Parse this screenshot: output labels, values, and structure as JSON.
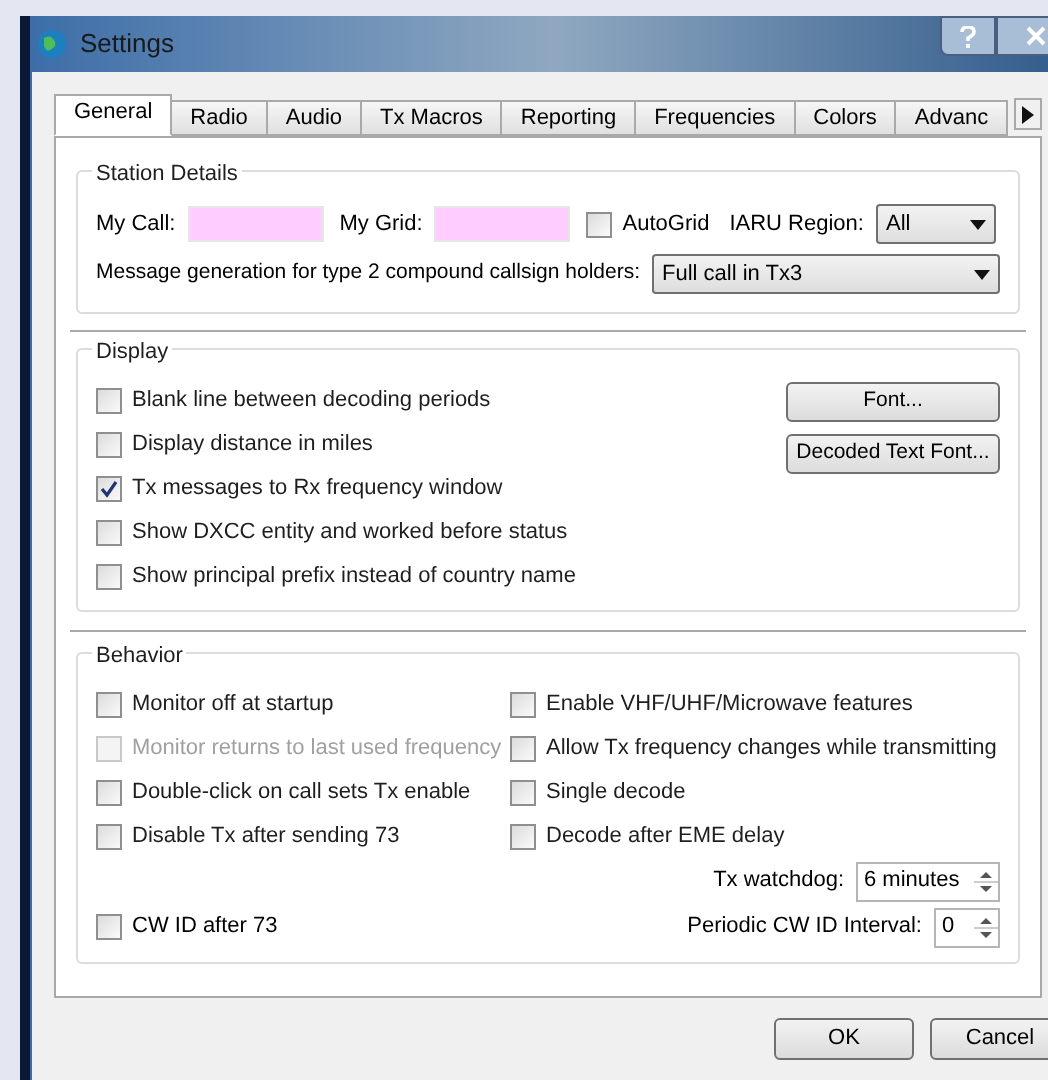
{
  "window": {
    "title": "Settings"
  },
  "tabs": [
    {
      "label": "General",
      "selected": true
    },
    {
      "label": "Radio",
      "selected": false
    },
    {
      "label": "Audio",
      "selected": false
    },
    {
      "label": "Tx Macros",
      "selected": false
    },
    {
      "label": "Reporting",
      "selected": false
    },
    {
      "label": "Frequencies",
      "selected": false
    },
    {
      "label": "Colors",
      "selected": false
    },
    {
      "label": "Advanc",
      "selected": false
    }
  ],
  "station_details": {
    "title": "Station Details",
    "my_call": {
      "label": "My Call:"
    },
    "my_grid": {
      "label": "My Grid:"
    },
    "autogrid": {
      "label": "AutoGrid",
      "checked": false
    },
    "iaru_region": {
      "label": "IARU Region:",
      "value": "All"
    },
    "message_generation": {
      "label": "Message generation for type 2 compound callsign holders:",
      "value": "Full call in Tx3"
    }
  },
  "display": {
    "title": "Display",
    "options": [
      {
        "label": "Blank line between decoding periods",
        "checked": false
      },
      {
        "label": "Display distance in miles",
        "checked": false
      },
      {
        "label": "Tx messages to Rx frequency window",
        "checked": true
      },
      {
        "label": "Show DXCC entity and worked before status",
        "checked": false
      },
      {
        "label": "Show principal prefix instead of country name",
        "checked": false
      }
    ],
    "buttons": [
      "Font...",
      "Decoded Text Font..."
    ]
  },
  "behavior": {
    "title": "Behavior",
    "left_options": [
      {
        "label": "Monitor off at startup",
        "checked": false,
        "disabled": false
      },
      {
        "label": "Monitor returns to last used frequency",
        "checked": false,
        "disabled": true
      },
      {
        "label": "Double-click on call sets Tx enable",
        "checked": false,
        "disabled": false
      },
      {
        "label": "Disable Tx after sending 73",
        "checked": false,
        "disabled": false
      }
    ],
    "right_options": [
      {
        "label": "Enable VHF/UHF/Microwave features",
        "checked": false
      },
      {
        "label": "Allow Tx frequency changes while transmitting",
        "checked": false
      },
      {
        "label": "Single decode",
        "checked": false
      },
      {
        "label": "Decode after EME delay",
        "checked": false
      }
    ],
    "tx_watchdog": {
      "label": "Tx watchdog:",
      "value": "6 minutes"
    },
    "cw_id_after_73": {
      "label": "CW ID after 73",
      "checked": false
    },
    "periodic_cw_id": {
      "label": "Periodic CW ID Interval:",
      "value": "0"
    }
  },
  "dialog_buttons": [
    "OK",
    "Cancel"
  ]
}
